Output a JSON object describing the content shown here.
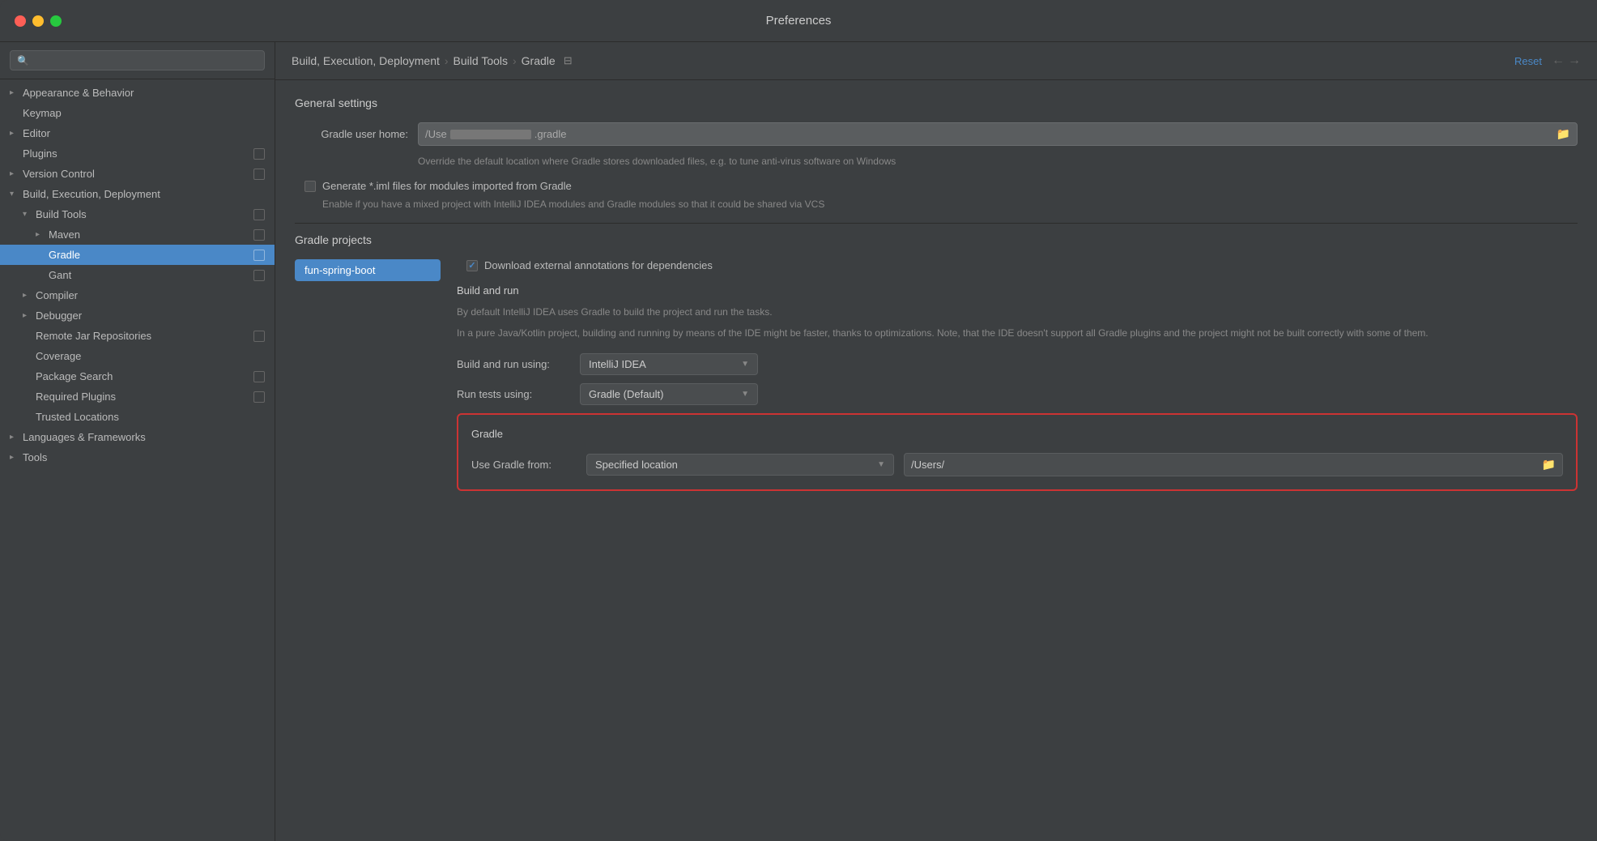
{
  "window": {
    "title": "Preferences"
  },
  "sidebar": {
    "search_placeholder": "🔍",
    "items": [
      {
        "id": "appearance-behavior",
        "label": "Appearance & Behavior",
        "level": 0,
        "arrow": "right",
        "has_icon": false
      },
      {
        "id": "keymap",
        "label": "Keymap",
        "level": 0,
        "arrow": "",
        "has_icon": false
      },
      {
        "id": "editor",
        "label": "Editor",
        "level": 0,
        "arrow": "right",
        "has_icon": false
      },
      {
        "id": "plugins",
        "label": "Plugins",
        "level": 0,
        "arrow": "",
        "has_icon": true
      },
      {
        "id": "version-control",
        "label": "Version Control",
        "level": 0,
        "arrow": "right",
        "has_icon": true
      },
      {
        "id": "build-exec-deploy",
        "label": "Build, Execution, Deployment",
        "level": 0,
        "arrow": "down",
        "has_icon": false
      },
      {
        "id": "build-tools",
        "label": "Build Tools",
        "level": 1,
        "arrow": "down",
        "has_icon": true
      },
      {
        "id": "maven",
        "label": "Maven",
        "level": 2,
        "arrow": "right",
        "has_icon": true
      },
      {
        "id": "gradle",
        "label": "Gradle",
        "level": 2,
        "arrow": "",
        "has_icon": true,
        "selected": true
      },
      {
        "id": "gant",
        "label": "Gant",
        "level": 2,
        "arrow": "",
        "has_icon": true
      },
      {
        "id": "compiler",
        "label": "Compiler",
        "level": 1,
        "arrow": "right",
        "has_icon": false
      },
      {
        "id": "debugger",
        "label": "Debugger",
        "level": 1,
        "arrow": "right",
        "has_icon": false
      },
      {
        "id": "remote-jar-repositories",
        "label": "Remote Jar Repositories",
        "level": 1,
        "arrow": "",
        "has_icon": true
      },
      {
        "id": "coverage",
        "label": "Coverage",
        "level": 1,
        "arrow": "",
        "has_icon": false
      },
      {
        "id": "package-search",
        "label": "Package Search",
        "level": 1,
        "arrow": "",
        "has_icon": true
      },
      {
        "id": "required-plugins",
        "label": "Required Plugins",
        "level": 1,
        "arrow": "",
        "has_icon": true
      },
      {
        "id": "trusted-locations",
        "label": "Trusted Locations",
        "level": 1,
        "arrow": "",
        "has_icon": false
      },
      {
        "id": "languages-frameworks",
        "label": "Languages & Frameworks",
        "level": 0,
        "arrow": "right",
        "has_icon": false
      },
      {
        "id": "tools",
        "label": "Tools",
        "level": 0,
        "arrow": "right",
        "has_icon": false
      }
    ]
  },
  "header": {
    "breadcrumb": [
      {
        "label": "Build, Execution, Deployment"
      },
      {
        "label": "Build Tools"
      },
      {
        "label": "Gradle"
      }
    ],
    "reset_label": "Reset",
    "nav_back": "←",
    "nav_forward": "→",
    "settings_icon": "⊟"
  },
  "content": {
    "general_settings_title": "General settings",
    "gradle_user_home_label": "Gradle user home:",
    "gradle_user_home_prefix": "/Use",
    "gradle_user_home_suffix": ".gradle",
    "gradle_user_home_hint": "Override the default location where Gradle stores downloaded files, e.g. to tune anti-virus software on Windows",
    "generate_iml_label": "Generate *.iml files for modules imported from Gradle",
    "generate_iml_hint": "Enable if you have a mixed project with IntelliJ IDEA modules and Gradle modules so that it could be shared via VCS",
    "gradle_projects_title": "Gradle projects",
    "project_name": "fun-spring-boot",
    "download_annotations_label": "Download external annotations for dependencies",
    "build_and_run_title": "Build and run",
    "build_run_desc1": "By default IntelliJ IDEA uses Gradle to build the project and run the tasks.",
    "build_run_desc2": "In a pure Java/Kotlin project, building and running by means of the IDE might be faster, thanks to optimizations. Note, that the IDE doesn't support all Gradle plugins and the project might not be built correctly with some of them.",
    "build_and_run_using_label": "Build and run using:",
    "build_and_run_using_value": "IntelliJ IDEA",
    "run_tests_using_label": "Run tests using:",
    "run_tests_using_value": "Gradle (Default)",
    "gradle_section_title": "Gradle",
    "use_gradle_from_label": "Use Gradle from:",
    "use_gradle_from_value": "Specified location",
    "gradle_path_value": "/Users/"
  }
}
